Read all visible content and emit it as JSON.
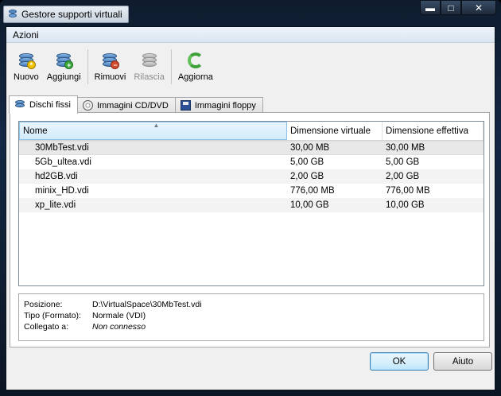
{
  "window": {
    "title": "Gestore supporti virtuali",
    "min_glyph": "▬",
    "max_glyph": "□",
    "close_glyph": "✕"
  },
  "menu": {
    "items": [
      "Azioni"
    ]
  },
  "toolbar": {
    "buttons": [
      {
        "label": "Nuovo",
        "icon": "disk-new-icon",
        "enabled": true
      },
      {
        "label": "Aggiungi",
        "icon": "disk-add-icon",
        "enabled": true
      },
      {
        "label": "Rimuovi",
        "icon": "disk-remove-icon",
        "enabled": true
      },
      {
        "label": "Rilascia",
        "icon": "disk-release-icon",
        "enabled": false
      },
      {
        "label": "Aggiorna",
        "icon": "refresh-icon",
        "enabled": true
      }
    ]
  },
  "tabs": [
    {
      "label": "Dischi fissi",
      "icon": "hard-disk-icon",
      "active": true
    },
    {
      "label": "Immagini CD/DVD",
      "icon": "cd-icon",
      "active": false
    },
    {
      "label": "Immagini floppy",
      "icon": "floppy-icon",
      "active": false
    }
  ],
  "table": {
    "sort_glyph": "▲",
    "columns": [
      "Nome",
      "Dimensione virtuale",
      "Dimensione effettiva"
    ],
    "rows": [
      [
        "30MbTest.vdi",
        "30,00 MB",
        "30,00 MB"
      ],
      [
        "5Gb_ultea.vdi",
        "5,00 GB",
        "5,00 GB"
      ],
      [
        "hd2GB.vdi",
        "2,00 GB",
        "2,00 GB"
      ],
      [
        "minix_HD.vdi",
        "776,00 MB",
        "776,00 MB"
      ],
      [
        "xp_lite.vdi",
        "10,00 GB",
        "10,00 GB"
      ]
    ],
    "selected_row": 0
  },
  "details": {
    "position_label": "Posizione:",
    "position_value": "D:\\VirtualSpace\\30MbTest.vdi",
    "type_label": "Tipo (Formato):",
    "type_value": "Normale (VDI)",
    "attached_label": "Collegato a:",
    "attached_value": "Non connesso"
  },
  "buttons": {
    "ok": "OK",
    "help": "Aiuto"
  },
  "colors": {
    "accent_tab_border": "#a8a8a8",
    "sorted_header": "#d3ebfa",
    "ok_border": "#3c7fb1"
  }
}
